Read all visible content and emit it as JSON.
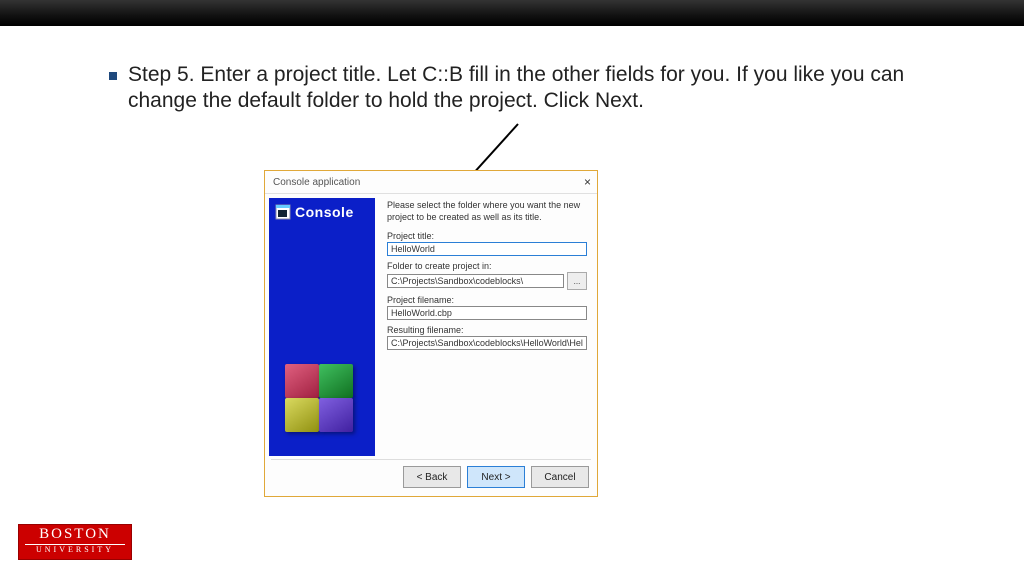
{
  "step_text": "Step 5.  Enter a project title. Let C::B fill in the other fields for you. If you like you can change the default folder to hold the project. Click Next.",
  "dialog": {
    "title": "Console application",
    "side_label": "Console",
    "hint": "Please select the folder where you want the new project to be created as well as its title.",
    "fields": {
      "project_title_label": "Project title:",
      "project_title_value": "HelloWorld",
      "folder_label": "Folder to create project in:",
      "folder_value": "C:\\Projects\\Sandbox\\codeblocks\\",
      "browse_label": "...",
      "project_filename_label": "Project filename:",
      "project_filename_value": "HelloWorld.cbp",
      "resulting_label": "Resulting filename:",
      "resulting_value": "C:\\Projects\\Sandbox\\codeblocks\\HelloWorld\\HelloWorld"
    },
    "buttons": {
      "back": "< Back",
      "next": "Next >",
      "cancel": "Cancel"
    }
  },
  "logo": {
    "line1": "BOSTON",
    "line2": "UNIVERSITY"
  }
}
